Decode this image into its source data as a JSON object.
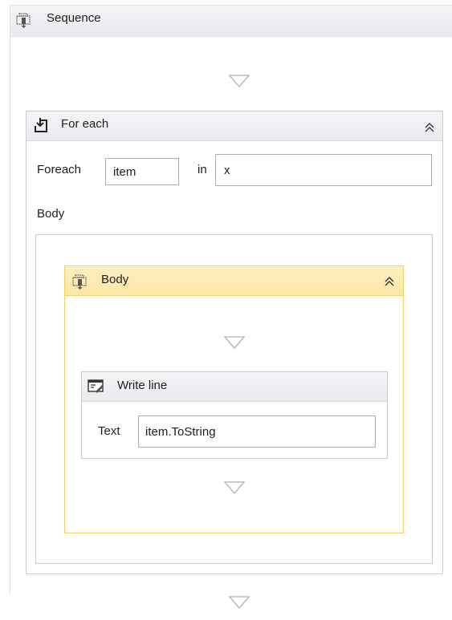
{
  "sequence": {
    "title": "Sequence",
    "icon": "sequence-icon"
  },
  "foreach": {
    "title": "For each",
    "icon": "foreach-icon",
    "foreach_label": "Foreach",
    "item_value": "item",
    "in_label": "in",
    "collection_value": "x",
    "body_label": "Body"
  },
  "body_sequence": {
    "title": "Body",
    "icon": "sequence-icon",
    "accent": "#f2d16a",
    "header_bg": "#fbe8a8"
  },
  "writeline": {
    "title": "Write line",
    "icon": "writeline-icon",
    "text_label": "Text",
    "text_value": "item.ToString"
  },
  "colors": {
    "border": "#c9ccd2",
    "header_bg": "#eceef2",
    "triangle": "#a9b0bd"
  }
}
